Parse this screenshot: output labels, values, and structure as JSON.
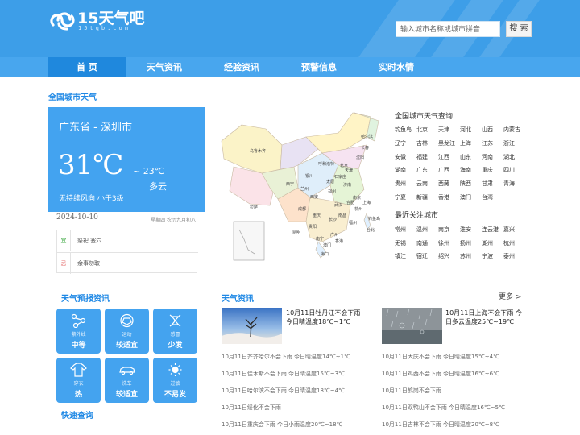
{
  "header": {
    "logo_text": "15天气吧",
    "logo_sub": "15tqb.com",
    "search_placeholder": "输入城市名称或城市拼音",
    "search_button": "搜 索"
  },
  "nav": [
    {
      "label": "首 页",
      "active": true
    },
    {
      "label": "天气资讯"
    },
    {
      "label": "经验资讯"
    },
    {
      "label": "预警信息"
    },
    {
      "label": "实时水情"
    }
  ],
  "national_title": "全国城市天气",
  "weather": {
    "city": "广东省 - 深圳市",
    "temp": "31℃",
    "low": "~ 23℃",
    "condition": "多云",
    "wind": "无持续风向  小于3级"
  },
  "date": {
    "solar": "2024-10-10",
    "lunar": "星期四  农历九月初八"
  },
  "almanac": {
    "yi_tag": "宜",
    "yi": "祭祀 塞穴",
    "ji_tag": "忌",
    "ji": "余事勿取"
  },
  "city_query_title": "全国城市天气查询",
  "cities": [
    "钓鱼岛",
    "北京",
    "天津",
    "河北",
    "山西",
    "内蒙古",
    "辽宁",
    "吉林",
    "黑龙江",
    "上海",
    "江苏",
    "浙江",
    "安徽",
    "福建",
    "江西",
    "山东",
    "河南",
    "湖北",
    "湖南",
    "广东",
    "广西",
    "海南",
    "重庆",
    "四川",
    "贵州",
    "云南",
    "西藏",
    "陕西",
    "甘肃",
    "青海",
    "宁夏",
    "新疆",
    "香港",
    "澳门",
    "台湾"
  ],
  "recent_title": "最近关注城市",
  "recent_cities": [
    "常州",
    "温州",
    "南京",
    "淮安",
    "连云港",
    "嘉兴",
    "无锡",
    "南通",
    "徐州",
    "扬州",
    "湖州",
    "杭州",
    "镇江",
    "宿迁",
    "绍兴",
    "苏州",
    "宁波",
    "泰州"
  ],
  "map": {
    "provinces": [
      "乌鲁木齐",
      "西宁",
      "兰州",
      "拉萨",
      "成都",
      "贵阳",
      "昆明",
      "南宁",
      "海口",
      "广州",
      "长沙",
      "武汉",
      "郑州",
      "西安",
      "银川",
      "太原",
      "石家庄",
      "北京",
      "天津",
      "济南",
      "南京",
      "合肥",
      "上海",
      "杭州",
      "南昌",
      "福州",
      "台北",
      "香港",
      "澳门",
      "沈阳",
      "长春",
      "哈尔滨",
      "呼和浩特",
      "重庆",
      "钓鱼岛"
    ]
  },
  "forecast": {
    "title": "天气预报资讯",
    "tiles": [
      {
        "label": "紫外线",
        "value": "中等",
        "icon": "uv-icon"
      },
      {
        "label": "运动",
        "value": "较适宜",
        "icon": "ball-icon"
      },
      {
        "label": "感冒",
        "value": "少发",
        "icon": "dna-icon"
      },
      {
        "label": "穿衣",
        "value": "热",
        "icon": "shirt-icon"
      },
      {
        "label": "洗车",
        "value": "较适宜",
        "icon": "car-icon"
      },
      {
        "label": "过敏",
        "value": "不易发",
        "icon": "sun-icon"
      }
    ],
    "quick_query": "快速查询"
  },
  "news": {
    "title": "天气资讯",
    "more": "更多 >",
    "featured": [
      {
        "text": "10月11日牡丹江不会下雨 今日晴温度18℃~1℃"
      },
      {
        "text": "10月11日上海不会下雨 今日多云温度25℃~19℃"
      }
    ],
    "left": [
      "10月11日齐齐哈尔不会下雨 今日晴温度14℃~1℃",
      "10月11日佳木斯不会下雨 今日晴温度15℃~3℃",
      "10月11日哈尔滨不会下雨 今日晴温度18℃~4℃",
      "10月11日绥化不会下雨",
      "10月11日重庆会下雨 今日小雨温度20℃~18℃"
    ],
    "right": [
      "10月11日大庆不会下雨 今日晴温度15℃~4℃",
      "10月11日鸡西不会下雨 今日晴温度16℃~6℃",
      "10月11日鹤岗不会下雨",
      "10月11日双鸭山不会下雨 今日晴温度16℃~5℃",
      "10月11日吉林不会下雨 今日晴温度20℃~8℃"
    ]
  }
}
